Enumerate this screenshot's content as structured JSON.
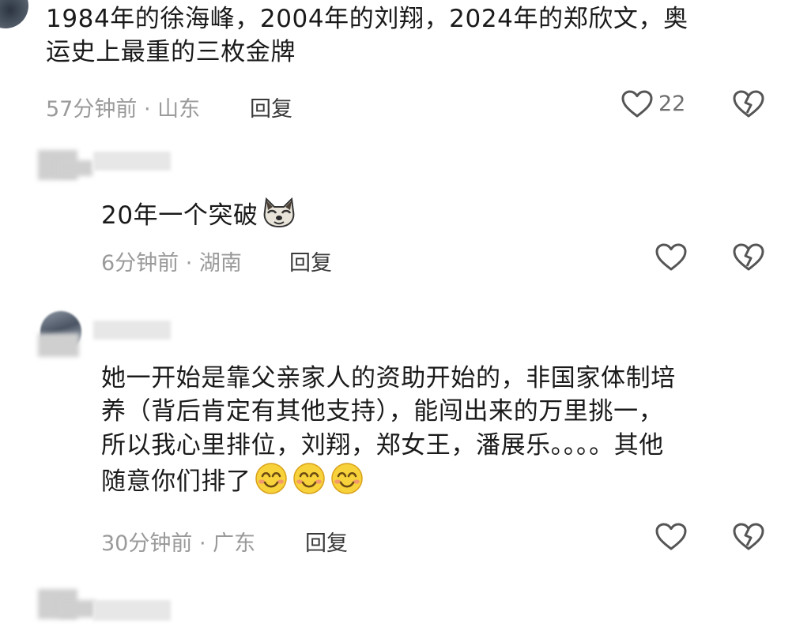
{
  "comments": [
    {
      "text_lines": [
        "1984年的徐海峰，2004年的刘翔，2024年的郑欣文，奥",
        "运史上最重的三枚金牌"
      ],
      "meta": "57分钟前 · 山东",
      "reply": "回复",
      "likes": "22"
    },
    {
      "text": "20年一个突破",
      "emoji": "doge-emoji",
      "meta": "6分钟前 · 湖南",
      "reply": "回复"
    },
    {
      "text_lines": [
        "她一开始是靠父亲家人的资助开始的，非国家体制培",
        "养（背后肯定有其他支持），能闯出来的万里挑一，",
        "所以我心里排位，刘翔，郑女王，潘展乐。。。。其他",
        "随意你们排了"
      ],
      "emoji": "smile-emoji",
      "meta": "30分钟前 · 广东",
      "reply": "回复"
    }
  ],
  "colors": {
    "text": "#1a1a1a",
    "meta": "#9a9a9a",
    "icon": "#555555",
    "emoji_yellow": "#f7d23a"
  }
}
